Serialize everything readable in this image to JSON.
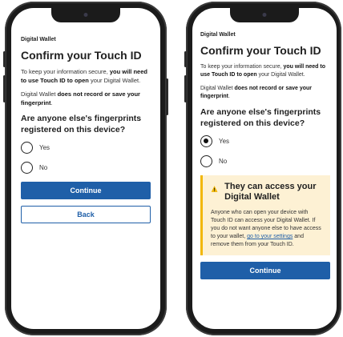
{
  "left": {
    "app_title": "Digital Wallet",
    "page_title": "Confirm your Touch ID",
    "intro_pre": "To keep your information secure, ",
    "intro_bold": "you will need to use Touch ID to open",
    "intro_post": " your Digital Wallet.",
    "record_pre": "Digital Wallet ",
    "record_bold": "does not record or save your fingerprint",
    "record_post": ".",
    "question": "Are anyone else's fingerprints registered on this device?",
    "options": [
      {
        "label": "Yes",
        "selected": false
      },
      {
        "label": "No",
        "selected": false
      }
    ],
    "continue_label": "Continue",
    "back_label": "Back"
  },
  "right": {
    "app_title": "Digital Wallet",
    "page_title": "Confirm your Touch ID",
    "intro_pre": "To keep your information secure, ",
    "intro_bold": "you will need to use Touch ID to open",
    "intro_post": " your Digital Wallet.",
    "record_pre": "Digital Wallet ",
    "record_bold": "does not record or save your fingerprint",
    "record_post": ".",
    "question": "Are anyone else's fingerprints registered on this device?",
    "options": [
      {
        "label": "Yes",
        "selected": true
      },
      {
        "label": "No",
        "selected": false
      }
    ],
    "warning": {
      "title": "They can access your Digital Wallet",
      "body_pre": "Anyone who can open your device with Touch ID can access your Digital Wallet. If you do not want anyone else to have access to your wallet, ",
      "link": "go to your settings",
      "body_post": " and remove them from your Touch ID."
    },
    "continue_label": "Continue"
  },
  "colors": {
    "primary": "#1f5fa8",
    "warning_bg": "#fdf1d4",
    "warning_accent": "#f2b705",
    "phone_frame": "#1b1b1b"
  }
}
